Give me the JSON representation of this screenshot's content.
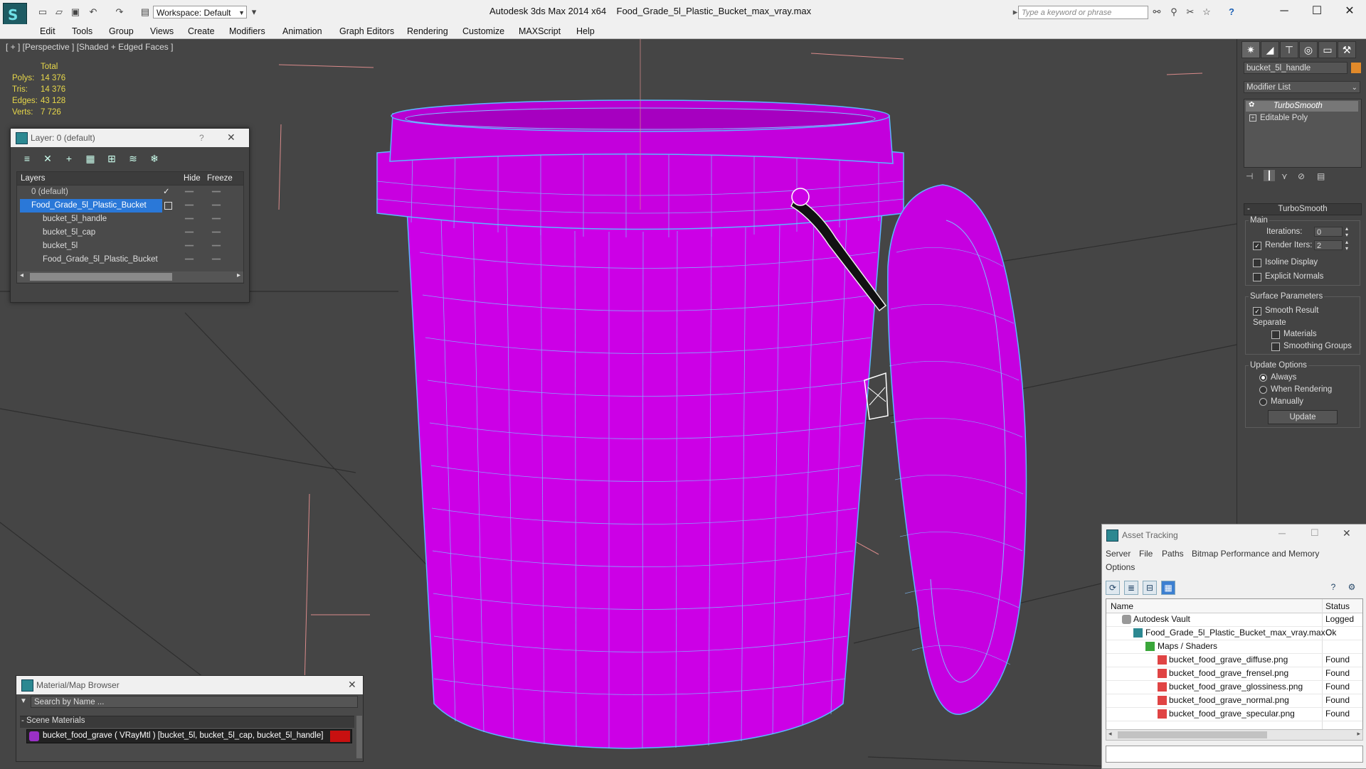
{
  "app": {
    "title": "Autodesk 3ds Max  2014 x64",
    "filename": "Food_Grade_5l_Plastic_Bucket_max_vray.max",
    "workspace": "Workspace: Default",
    "search_placeholder": "Type a keyword or phrase"
  },
  "menu": [
    "Edit",
    "Tools",
    "Group",
    "Views",
    "Create",
    "Modifiers",
    "Animation",
    "Graph Editors",
    "Rendering",
    "Customize",
    "MAXScript",
    "Help"
  ],
  "viewport": {
    "label": "[ + ] [Perspective ] [Shaded + Edged Faces ]",
    "stats": {
      "header": "Total",
      "rows": [
        {
          "label": "Polys:",
          "value": "14 376"
        },
        {
          "label": "Tris:",
          "value": "14 376"
        },
        {
          "label": "Edges:",
          "value": "43 128"
        },
        {
          "label": "Verts:",
          "value": "7 726"
        }
      ]
    },
    "object_color": "#cc00e6",
    "wire_color": "#4fb4ff"
  },
  "layer_dialog": {
    "title": "Layer: 0 (default)",
    "help": "?",
    "columns": [
      "Layers",
      "Hide",
      "Freeze"
    ],
    "rows": [
      {
        "name": "0 (default)"
      },
      {
        "name": "Food_Grade_5l_Plastic_Bucket"
      },
      {
        "name": "bucket_5l_handle"
      },
      {
        "name": "bucket_5l_cap"
      },
      {
        "name": "bucket_5l"
      },
      {
        "name": "Food_Grade_5l_Plastic_Bucket"
      }
    ]
  },
  "material_browser": {
    "title": "Material/Map Browser",
    "search_placeholder": "Search by Name ...",
    "section": "- Scene Materials",
    "item": "bucket_food_grave  ( VRayMtl ) [bucket_5l, bucket_5l_cap, bucket_5l_handle]"
  },
  "command_panel": {
    "object_name": "bucket_5l_handle",
    "modifier_list": "Modifier List",
    "stack": [
      "TurboSmooth",
      "Editable Poly"
    ],
    "rollout": "TurboSmooth",
    "main_group": "Main",
    "iterations_label": "Iterations:",
    "iterations_value": "0",
    "render_iters_label": "Render Iters:",
    "render_iters_value": "2",
    "isoline": "Isoline Display",
    "explicit_normals": "Explicit Normals",
    "surface_group": "Surface Parameters",
    "smooth_result": "Smooth Result",
    "separate": "Separate",
    "materials": "Materials",
    "smoothing_groups": "Smoothing Groups",
    "update_group": "Update Options",
    "always": "Always",
    "when_rendering": "When Rendering",
    "manually": "Manually",
    "update_button": "Update"
  },
  "asset_tracking": {
    "title": "Asset Tracking",
    "menu_row1": [
      "Server",
      "File",
      "Paths",
      "Bitmap Performance and Memory"
    ],
    "menu_row2": [
      "Options"
    ],
    "columns": [
      "Name",
      "Status"
    ],
    "rows": [
      {
        "name": "Autodesk Vault",
        "status": "Logged C"
      },
      {
        "name": "Food_Grade_5l_Plastic_Bucket_max_vray.max",
        "status": "Ok"
      },
      {
        "name": "Maps / Shaders",
        "status": ""
      },
      {
        "name": "bucket_food_grave_diffuse.png",
        "status": "Found"
      },
      {
        "name": "bucket_food_grave_frensel.png",
        "status": "Found"
      },
      {
        "name": "bucket_food_grave_glossiness.png",
        "status": "Found"
      },
      {
        "name": "bucket_food_grave_normal.png",
        "status": "Found"
      },
      {
        "name": "bucket_food_grave_specular.png",
        "status": "Found"
      }
    ]
  }
}
